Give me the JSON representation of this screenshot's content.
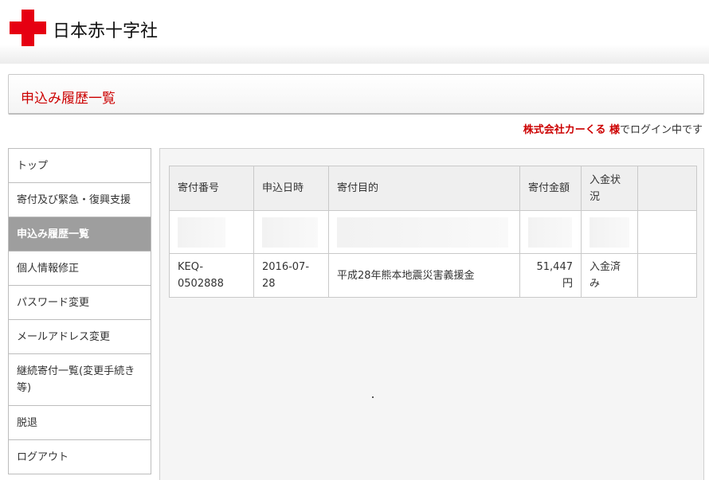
{
  "header": {
    "logo_text": "日本赤十字社",
    "brand_color": "#e60012"
  },
  "page_title": "申込み履歴一覧",
  "login": {
    "user_name": "株式会社カーくる 様",
    "suffix": "でログイン中です"
  },
  "sidebar": {
    "items": [
      {
        "label": "トップ",
        "active": false
      },
      {
        "label": "寄付及び緊急・復興支援",
        "active": false
      },
      {
        "label": "申込み履歴一覧",
        "active": true
      },
      {
        "label": "個人情報修正",
        "active": false
      },
      {
        "label": "パスワード変更",
        "active": false
      },
      {
        "label": "メールアドレス変更",
        "active": false
      },
      {
        "label": "継続寄付一覧(変更手続き等)",
        "active": false
      },
      {
        "label": "脱退",
        "active": false
      },
      {
        "label": "ログアウト",
        "active": false
      }
    ]
  },
  "table": {
    "headers": [
      "寄付番号",
      "申込日時",
      "寄付目的",
      "寄付金額",
      "入金状況",
      ""
    ],
    "rows": [
      {
        "number": "KEQ-0502888",
        "date": "2016-07-28",
        "purpose": "平成28年熊本地震災害義援金",
        "amount": "51,447円",
        "status": "入金済み",
        "extra": ""
      }
    ]
  }
}
